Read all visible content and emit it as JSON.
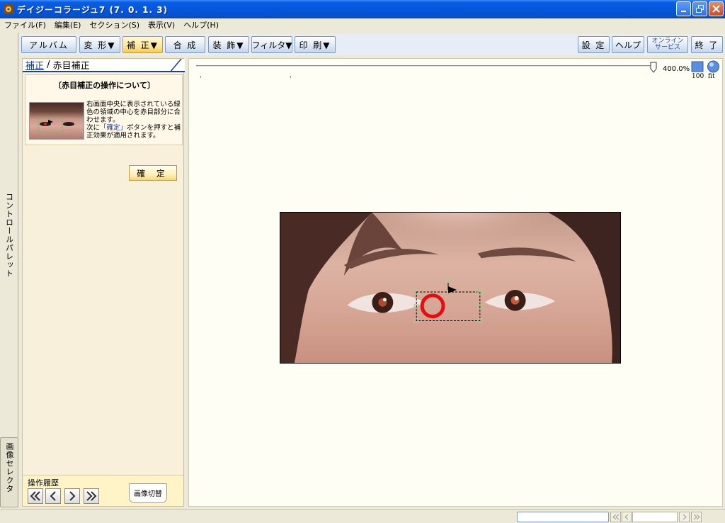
{
  "window": {
    "title": "デイジーコラージュ7 (7. 0. 1. 3)"
  },
  "menu": [
    {
      "label": "ファイル(F)"
    },
    {
      "label": "編集(E)"
    },
    {
      "label": "セクション(S)"
    },
    {
      "label": "表示(V)"
    },
    {
      "label": "ヘルプ(H)"
    }
  ],
  "toolbar": {
    "album": "アルバム",
    "transform": "変 形▼",
    "correct": "補 正▼",
    "compose": "合 成",
    "decorate": "装 飾▼",
    "filter": "フィルタ▼",
    "print": "印 刷▼",
    "settings": "設 定",
    "help": "ヘルプ",
    "online_line1": "オンライン",
    "online_line2": "サービス",
    "exit": "終 了"
  },
  "side_tabs": {
    "control_palette": "コントロールパレット",
    "image_selector": "画像セレクタ"
  },
  "panel": {
    "breadcrumb_link": "補正",
    "breadcrumb_sep": " / ",
    "breadcrumb_current": "赤目補正",
    "info_title": "〔赤目補正の操作について〕",
    "info_line1": "右画面中央に表示されている緑色の領域の中心を赤目部分に合わせます。",
    "info_line2_pre": "次に",
    "info_line2_hl": "「確定」",
    "info_line2_post": "ボタンを押すと補正効果が適用されます。",
    "confirm_button": "確 定",
    "history_label": "操作履歴",
    "switch_image": "画像切替"
  },
  "canvas": {
    "zoom_text": "400.0%",
    "zoom_100_label": "100",
    "zoom_fit_label": "fit"
  },
  "colors": {
    "title_bar": "#0656d8",
    "toolbar_active": "#ffe79a",
    "redeye_marker": "#e01010",
    "selection_green": "#8fd88f"
  }
}
